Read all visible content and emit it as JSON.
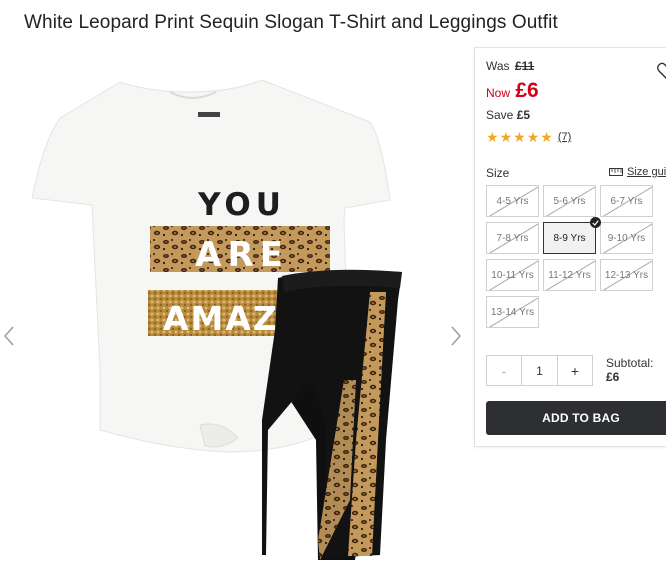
{
  "product": {
    "title": "White Leopard Print Sequin Slogan T-Shirt and Leggings Outfit",
    "image_alt": "White leopard print sequin slogan t-shirt and black leggings",
    "tshirt_text": [
      "YOU",
      "ARE",
      "AMAZI"
    ]
  },
  "gallery": {
    "prev_icon": "chevron-left-icon",
    "next_icon": "chevron-right-icon"
  },
  "pricing": {
    "was_label": "Was",
    "was_price": "£11",
    "now_label": "Now",
    "now_price": "£6",
    "save_label": "Save",
    "save_amount": "£5",
    "rating": 5,
    "rating_count": "(7)",
    "accent_color": "#d0021b",
    "star_color": "#f5a623"
  },
  "sizes": {
    "label": "Size",
    "guide_label": "Size gui",
    "options": [
      {
        "label": "4-5 Yrs",
        "available": false,
        "selected": false
      },
      {
        "label": "5-6 Yrs",
        "available": false,
        "selected": false
      },
      {
        "label": "6-7 Yrs",
        "available": false,
        "selected": false
      },
      {
        "label": "7-8 Yrs",
        "available": false,
        "selected": false
      },
      {
        "label": "8-9 Yrs",
        "available": true,
        "selected": true
      },
      {
        "label": "9-10 Yrs",
        "available": false,
        "selected": false
      },
      {
        "label": "10-11 Yrs",
        "available": false,
        "selected": false
      },
      {
        "label": "11-12 Yrs",
        "available": false,
        "selected": false
      },
      {
        "label": "12-13 Yrs",
        "available": false,
        "selected": false
      },
      {
        "label": "13-14 Yrs",
        "available": false,
        "selected": false
      }
    ]
  },
  "quantity": {
    "minus": "-",
    "value": "1",
    "plus": "+"
  },
  "subtotal": {
    "label": "Subtotal:",
    "value": "£6"
  },
  "cart": {
    "add_label": "ADD TO BAG",
    "button_color": "#2d2f33"
  }
}
